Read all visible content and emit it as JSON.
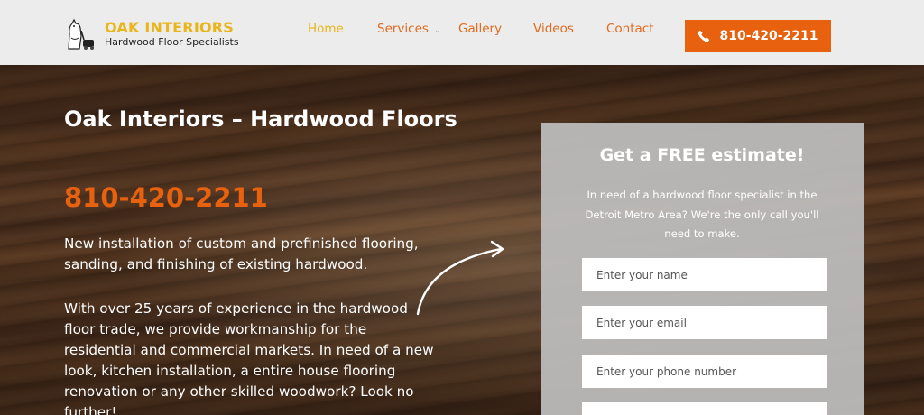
{
  "brand": {
    "title": "OAK INTERIORS",
    "subtitle": "Hardwood Floor Specialists",
    "logo_icon": "dog-with-floor-sander-icon"
  },
  "nav": {
    "items": [
      {
        "label": "Home",
        "active": true
      },
      {
        "label": "Services",
        "has_dropdown": true
      },
      {
        "label": "Gallery"
      },
      {
        "label": "Videos"
      },
      {
        "label": "Contact"
      }
    ],
    "phone_button": {
      "label": "810-420-2211",
      "icon": "phone-icon"
    }
  },
  "hero": {
    "title": "Oak Interiors – Hardwood Floors",
    "phone": "810-420-2211",
    "paragraph1": "New installation of custom and prefinished flooring, sanding, and finishing of existing hardwood.",
    "paragraph2": "With over 25 years of experience in the hardwood floor trade, we provide workmanship for the residential and commercial markets. In need of a new look, kitchen installation, a entire house flooring renovation or any other skilled woodwork? Look no further!"
  },
  "estimate_form": {
    "title": "Get a FREE estimate!",
    "description": "In need of a hardwood floor specialist in the Detroit Metro Area? We're the only call you'll need to make.",
    "name_placeholder": "Enter your name",
    "email_placeholder": "Enter your email",
    "phone_placeholder": "Enter your phone number",
    "name_value": "",
    "email_value": "",
    "phone_value": ""
  },
  "colors": {
    "accent_orange": "#e8610f",
    "brand_gold": "#e8b51a",
    "header_bg": "#ececec",
    "form_bg": "#bebebe"
  }
}
